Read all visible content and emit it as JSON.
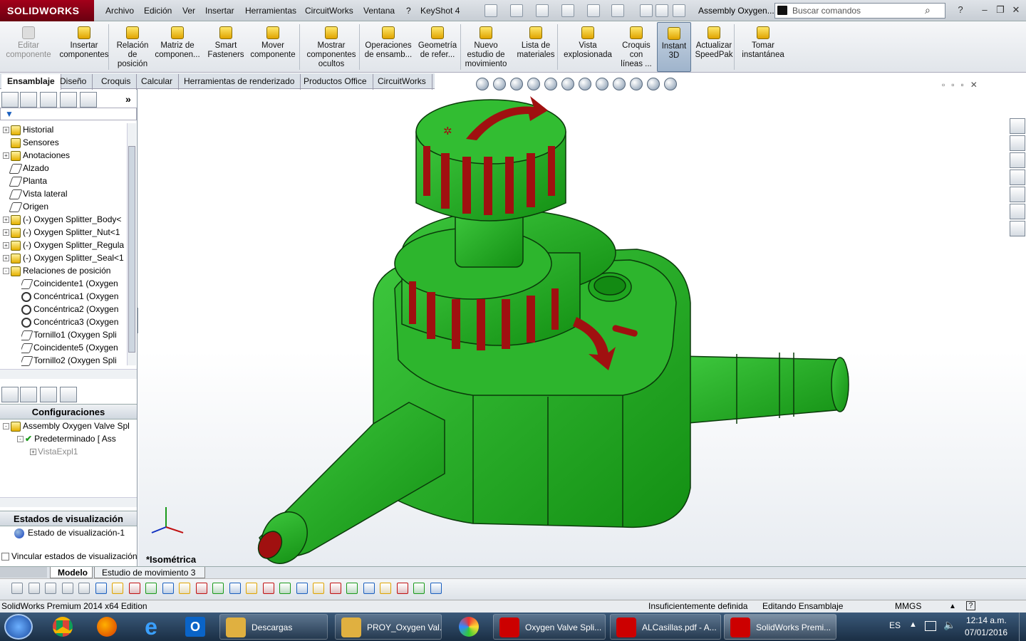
{
  "app": {
    "logo": "SOLIDWORKS",
    "title": "Assembly Oxygen...",
    "search_placeholder": "Buscar comandos"
  },
  "menu": [
    "Archivo",
    "Edición",
    "Ver",
    "Insertar",
    "Herramientas",
    "CircuitWorks",
    "Ventana",
    "?",
    "KeyShot 4"
  ],
  "commands": [
    {
      "label": "Editar\ncomponente",
      "enabled": false
    },
    {
      "label": "Insertar\ncomponentes"
    },
    {
      "label": "Relación\nde\nposición"
    },
    {
      "label": "Matriz de\ncomponen..."
    },
    {
      "label": "Smart\nFasteners"
    },
    {
      "label": "Mover\ncomponente"
    },
    {
      "label": "Mostrar\ncomponentes\nocultos"
    },
    {
      "label": "Operaciones\nde ensamb..."
    },
    {
      "label": "Geometría\nde refer..."
    },
    {
      "label": "Nuevo\nestudio de\nmovimiento"
    },
    {
      "label": "Lista de\nmateriales"
    },
    {
      "label": "Vista\nexplosionada"
    },
    {
      "label": "Croquis\ncon\nlíneas ..."
    },
    {
      "label": "Instant\n3D",
      "active": true
    },
    {
      "label": "Actualizar\nSpeedPak"
    },
    {
      "label": "Tomar\ninstantánea"
    }
  ],
  "tabs": [
    "Ensamblaje",
    "Diseño",
    "Croquis",
    "Calcular",
    "Herramientas de renderizado",
    "Productos Office",
    "CircuitWorks"
  ],
  "tree": [
    {
      "label": "Historial",
      "exp": "+"
    },
    {
      "label": "Sensores"
    },
    {
      "label": "Anotaciones",
      "exp": "+"
    },
    {
      "label": "Alzado",
      "icon": "plane"
    },
    {
      "label": "Planta",
      "icon": "plane"
    },
    {
      "label": "Vista lateral",
      "icon": "plane"
    },
    {
      "label": "Origen",
      "icon": "plane"
    },
    {
      "label": "(-) Oxygen Splitter_Body<",
      "exp": "+"
    },
    {
      "label": "(-) Oxygen Splitter_Nut<1",
      "exp": "+"
    },
    {
      "label": "(-) Oxygen Splitter_Regula",
      "exp": "+"
    },
    {
      "label": "(-) Oxygen Splitter_Seal<1",
      "exp": "+"
    },
    {
      "label": "Relaciones de posición",
      "exp": "-"
    },
    {
      "label": "Coincidente1 (Oxygen",
      "indent": 1,
      "icon": "plane"
    },
    {
      "label": "Concéntrica1 (Oxygen",
      "indent": 1,
      "icon": "mate"
    },
    {
      "label": "Concéntrica2 (Oxygen",
      "indent": 1,
      "icon": "mate"
    },
    {
      "label": "Concéntrica3 (Oxygen",
      "indent": 1,
      "icon": "mate"
    },
    {
      "label": "Tornillo1 (Oxygen Spli",
      "indent": 1,
      "icon": "plane"
    },
    {
      "label": "Coincidente5 (Oxygen",
      "indent": 1,
      "icon": "plane"
    },
    {
      "label": "Tornillo2 (Oxygen Spli",
      "indent": 1,
      "icon": "plane"
    }
  ],
  "config": {
    "header": "Configuraciones",
    "root": "Assembly Oxygen Valve Split",
    "default": "Predeterminado [ Ass",
    "exploded": "VistaExpl1"
  },
  "display": {
    "header": "Estados de visualización",
    "state": "Estado de visualización-1",
    "link": "Vincular estados de visualización a"
  },
  "viewport": {
    "view_name": "*Isométrica",
    "colors": {
      "body": "#22a822",
      "accent": "#a01010"
    }
  },
  "bottom_tabs": [
    "Modelo",
    "Estudio de movimiento 3"
  ],
  "status": {
    "edition": "SolidWorks Premium 2014 x64 Edition",
    "defined": "Insuficientemente definida",
    "mode": "Editando Ensamblaje",
    "units": "MMGS"
  },
  "taskbar": {
    "items": [
      "Descargas",
      "PROY_Oxygen Val...",
      "Oxygen Valve Spli...",
      "ALCasillas.pdf - A...",
      "SolidWorks Premi..."
    ],
    "lang": "ES",
    "time": "12:14 a.m.",
    "date": "07/01/2016"
  }
}
